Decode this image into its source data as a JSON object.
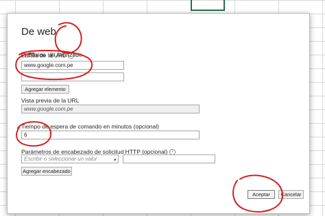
{
  "dialog": {
    "title": "De web",
    "radio_basic": "Básico",
    "radio_advanced": "Avanzado",
    "url_parts_label": "Partes de la URL",
    "url_part_1": "www.google.com.pe",
    "url_part_2": "",
    "add_element_button": "Agregar elemento",
    "preview_label": "Vista previa de la URL",
    "preview_value": "www.google.com.pe",
    "timeout_label": "Tiempo de espera de comando en minutos (opcional)",
    "timeout_value": "6",
    "http_params_label": "Parámetros de encabezado de solicitud HTTP (opcional)",
    "header_select_placeholder": "Escribir o seleccionar un valor",
    "header_value": "",
    "add_header_button": "Agregar encabezado",
    "accept_button": "Aceptar",
    "cancel_button": "Cancelar"
  },
  "colors": {
    "annotation": "#d61f1f",
    "grid_line": "#d9d9d9",
    "excel_selection": "#1e7145"
  },
  "icons": [
    "info-icon",
    "chevron-down-icon"
  ]
}
